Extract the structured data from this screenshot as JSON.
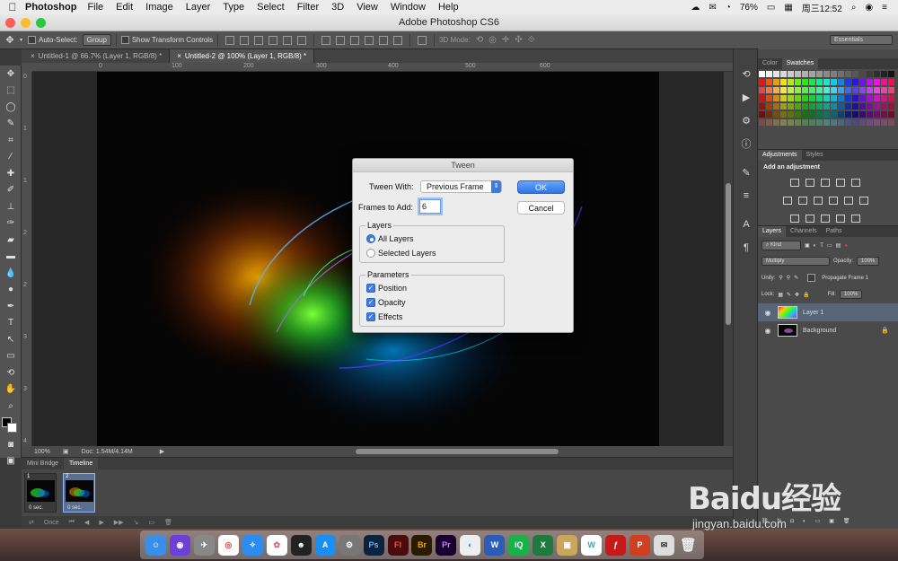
{
  "menubar": {
    "app": "Photoshop",
    "items": [
      "File",
      "Edit",
      "Image",
      "Layer",
      "Type",
      "Select",
      "Filter",
      "3D",
      "View",
      "Window",
      "Help"
    ],
    "battery": "76%",
    "clock": "周三12:52"
  },
  "window": {
    "title": "Adobe Photoshop CS6"
  },
  "options": {
    "auto_select_label": "Auto-Select:",
    "auto_select_value": "Group",
    "transform_label": "Show Transform Controls",
    "mode_3d_label": "3D Mode:"
  },
  "workspace_switcher": "Essentials",
  "doc_tabs": [
    {
      "label": "Untitled-1 @ 66.7% (Layer 1, RGB/8) *"
    },
    {
      "label": "Untitled-2 @ 100% (Layer 1, RGB/8) *"
    }
  ],
  "ruler": {
    "h_ticks": [
      "0",
      "100",
      "200",
      "300",
      "400",
      "500",
      "600"
    ],
    "v_ticks": [
      "0",
      "1",
      "1",
      "2",
      "2",
      "3",
      "3",
      "4"
    ]
  },
  "status": {
    "zoom": "100%",
    "doc": "Doc: 1.54M/4.14M"
  },
  "timeline": {
    "tabs": [
      "Mini Bridge",
      "Timeline"
    ],
    "frames": [
      {
        "num": "1",
        "delay": "0 sec."
      },
      {
        "num": "2",
        "delay": "0 sec."
      }
    ],
    "loop": "Once"
  },
  "panels": {
    "color_tabs": [
      "Color",
      "Swatches"
    ],
    "adjust_tabs": [
      "Adjustments",
      "Styles"
    ],
    "adjust_title": "Add an adjustment",
    "layer_tabs": [
      "Layers",
      "Channels",
      "Paths"
    ],
    "kind": "Kind",
    "blend_mode": "Multiply",
    "opacity_label": "Opacity:",
    "opacity_value": "100%",
    "unify_label": "Unify:",
    "propagate_label": "Propagate Frame 1",
    "lock_label": "Lock:",
    "fill_label": "Fill:",
    "fill_value": "100%",
    "layers": [
      {
        "name": "Layer 1"
      },
      {
        "name": "Background"
      }
    ]
  },
  "dialog": {
    "title": "Tween",
    "tween_with_label": "Tween With:",
    "tween_with_value": "Previous Frame",
    "frames_label": "Frames to Add:",
    "frames_value": "6",
    "ok": "OK",
    "cancel": "Cancel",
    "layers_group": "Layers",
    "all_layers": "All Layers",
    "selected_layers": "Selected Layers",
    "params_group": "Parameters",
    "position": "Position",
    "opacity": "Opacity",
    "effects": "Effects"
  },
  "watermark": {
    "logo": "Baidu经验",
    "url": "jingyan.baidu.com"
  },
  "colors": {
    "accent": "#3c7ee5",
    "panel": "#535353",
    "selection": "#586577"
  }
}
